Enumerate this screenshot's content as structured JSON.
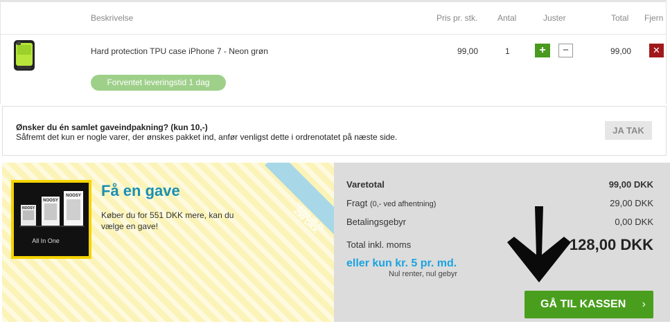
{
  "cart": {
    "headers": {
      "description": "Beskrivelse",
      "unit_price": "Pris pr. stk.",
      "quantity": "Antal",
      "adjust": "Juster",
      "total": "Total",
      "remove": "Fjern"
    },
    "item": {
      "name": "Hard protection TPU case iPhone 7 - Neon grøn",
      "unit_price": "99,00",
      "quantity": "1",
      "total": "99,00",
      "plus": "+",
      "minus": "−",
      "remove": "✕",
      "delivery_badge": "Forventet leveringstid 1 dag",
      "thumbnail_icon": "phone-case-icon"
    }
  },
  "gift_wrap": {
    "question": "Ønsker du én samlet gaveindpakning? (kun 10,-)",
    "description": "Såfremt det kun er nogle varer, der ønskes pakket ind, anfør venligst dette i ordrenotatet på næste side.",
    "button": "JA TAK"
  },
  "promo": {
    "title": "Få en gave",
    "text": "Køber du for 551 DKK mere, kan du vælge en gave!",
    "ribbon_line1": "VÆRDI OP TIL",
    "ribbon_line2": "299 DKK",
    "product_label": "All In One",
    "product_brand": "NOOSY"
  },
  "totals": {
    "rows": [
      {
        "label": "Varetotal",
        "sub": "",
        "value": "99,00 DKK"
      },
      {
        "label": "Fragt",
        "sub": "(0,- ved afhentning)",
        "value": "29,00  DKK"
      },
      {
        "label": "Betalingsgebyr",
        "sub": "",
        "value": "0,00  DKK"
      }
    ],
    "grand_label": "Total inkl. moms",
    "grand_value": "128,00 DKK",
    "monthly": "eller kun kr. 5 pr. md.",
    "monthly_sub": "Nul renter, nul gebyr",
    "checkout": "GÅ TIL KASSEN",
    "checkout_icon": "chevron-right-icon"
  },
  "colors": {
    "green": "#4a9e1e",
    "red": "#a0191a",
    "blue": "#1a8fb0",
    "promo_bg": "#fbf3b8",
    "totals_bg": "#dcdcdc"
  }
}
